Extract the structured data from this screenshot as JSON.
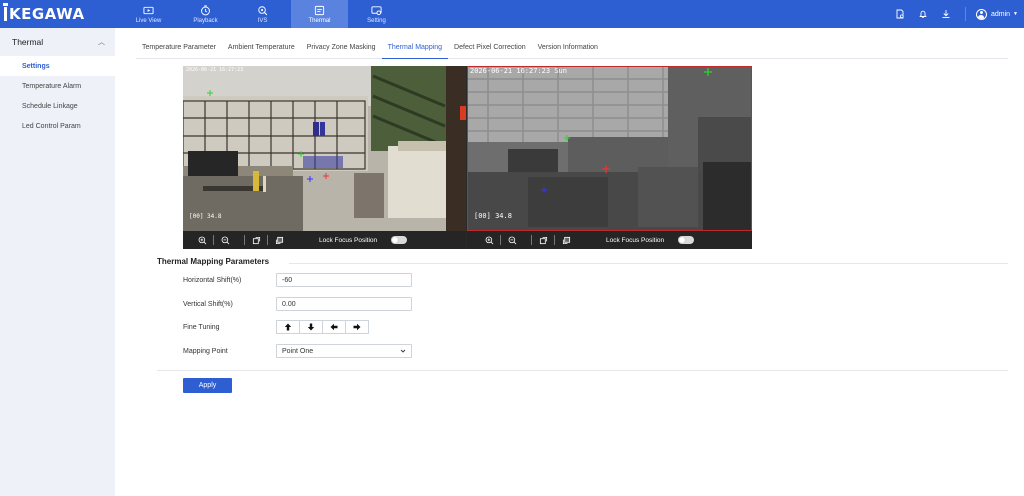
{
  "brand": {
    "logo_text": "KEGAWA"
  },
  "nav": {
    "items": [
      {
        "label": "Live View",
        "icon": "live-view-icon"
      },
      {
        "label": "Playback",
        "icon": "playback-icon"
      },
      {
        "label": "IVS",
        "icon": "ivs-icon"
      },
      {
        "label": "Thermal",
        "icon": "thermal-icon",
        "active": true
      },
      {
        "label": "Setting",
        "icon": "setting-icon"
      }
    ]
  },
  "header": {
    "user": "admin"
  },
  "sidebar": {
    "title": "Thermal",
    "items": [
      {
        "label": "Settings",
        "active": true
      },
      {
        "label": "Temperature Alarm"
      },
      {
        "label": "Schedule Linkage"
      },
      {
        "label": "Led Control Param"
      }
    ]
  },
  "tabs": [
    {
      "label": "Temperature Parameter"
    },
    {
      "label": "Ambient Temperature"
    },
    {
      "label": "Privacy Zone Masking"
    },
    {
      "label": "Thermal Mapping",
      "active": true
    },
    {
      "label": "Defect Pixel Correction"
    },
    {
      "label": "Version Information"
    }
  ],
  "video": {
    "left": {
      "timestamp": "2026-06-21 16:27:23",
      "readout": "[00] 34.8"
    },
    "right": {
      "timestamp": "2026-06-21 16:27:23 Sun",
      "readout": "[00] 34.8"
    },
    "lock_focus_label": "Lock Focus Position"
  },
  "params": {
    "title": "Thermal Mapping Parameters",
    "horizontal_label": "Horizontal Shift(%)",
    "horizontal_value": "-60",
    "vertical_label": "Vertical Shift(%)",
    "vertical_value": "0.00",
    "fine_tuning_label": "Fine Tuning",
    "mapping_point_label": "Mapping Point",
    "mapping_point_value": "Point One"
  },
  "apply_label": "Apply",
  "colors": {
    "primary": "#2d5fd3",
    "thermal_border": "#c2292f"
  }
}
